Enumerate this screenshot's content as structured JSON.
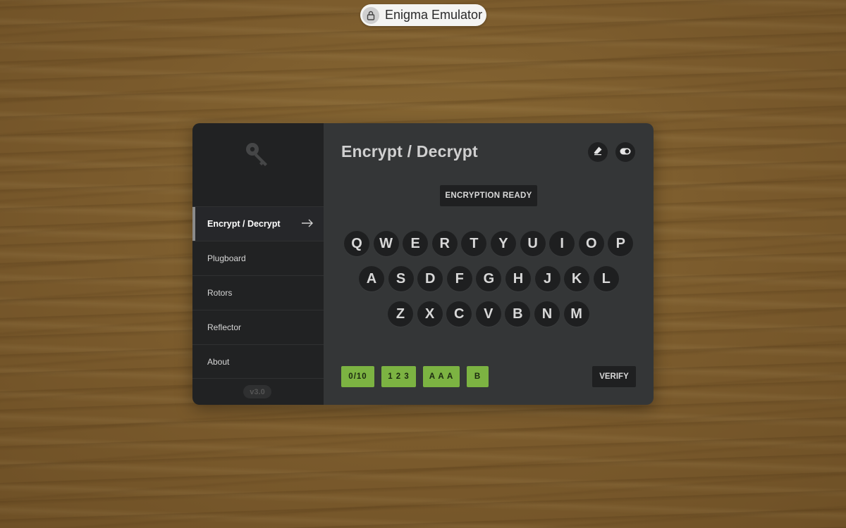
{
  "window": {
    "title": "Enigma Emulator"
  },
  "sidebar": {
    "logo_icon": "key-icon",
    "items": [
      {
        "label": "Encrypt / Decrypt",
        "active": true
      },
      {
        "label": "Plugboard",
        "active": false
      },
      {
        "label": "Rotors",
        "active": false
      },
      {
        "label": "Reflector",
        "active": false
      },
      {
        "label": "About",
        "active": false
      }
    ],
    "version": "v3.0"
  },
  "main": {
    "title": "Encrypt / Decrypt",
    "actions": [
      "eraser-icon",
      "toggle-icon"
    ],
    "status": "ENCRYPTION READY",
    "keyboard": {
      "rows": [
        [
          "Q",
          "W",
          "E",
          "R",
          "T",
          "Y",
          "U",
          "I",
          "O",
          "P"
        ],
        [
          "A",
          "S",
          "D",
          "F",
          "G",
          "H",
          "J",
          "K",
          "L"
        ],
        [
          "Z",
          "X",
          "C",
          "V",
          "B",
          "N",
          "M"
        ]
      ]
    },
    "chips": {
      "plugboard": "0/10",
      "rotors": "1 2 3",
      "positions": "A A A",
      "reflector": "B"
    },
    "verify_label": "VERIFY"
  },
  "colors": {
    "accent": "#7cb342",
    "panel": "#343637",
    "sidebar": "#212223",
    "key": "#1e1f20"
  }
}
